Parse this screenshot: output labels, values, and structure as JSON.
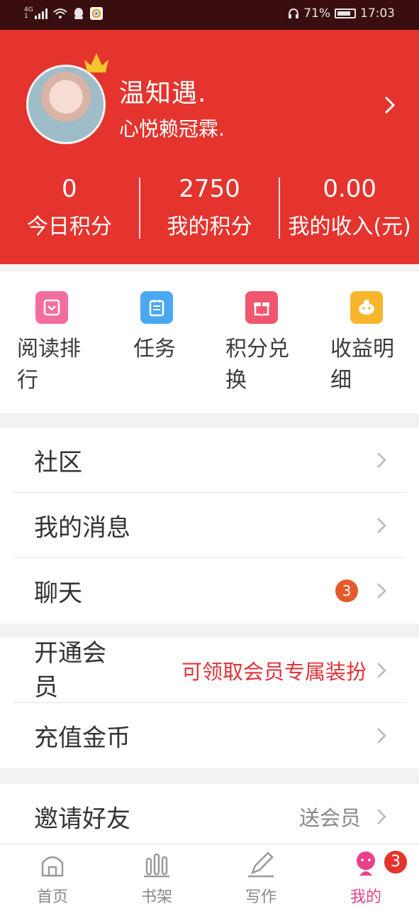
{
  "status_bar": {
    "network": "4G",
    "battery": "71%",
    "time": "17:03"
  },
  "profile": {
    "name": "温知遇.",
    "signature": "心悦赖冠霖."
  },
  "stats": [
    {
      "value": "0",
      "label": "今日积分"
    },
    {
      "value": "2750",
      "label": "我的积分"
    },
    {
      "value": "0.00",
      "label": "我的收入(元)"
    }
  ],
  "quick_actions": [
    {
      "label": "阅读排行",
      "icon": "ranking-icon",
      "color": "#f36da0"
    },
    {
      "label": "任务",
      "icon": "task-icon",
      "color": "#4aa8f0"
    },
    {
      "label": "积分兑换",
      "icon": "gift-icon",
      "color": "#f0566e"
    },
    {
      "label": "收益明细",
      "icon": "earnings-icon",
      "color": "#f7b62b"
    }
  ],
  "menu_group1": [
    {
      "label": "社区"
    },
    {
      "label": "我的消息"
    },
    {
      "label": "聊天",
      "badge": "3"
    }
  ],
  "menu_group2": [
    {
      "label": "开通会员",
      "note": "可领取会员专属装扮"
    },
    {
      "label": "充值金币"
    }
  ],
  "menu_group3": [
    {
      "label": "邀请好友",
      "note": "送会员"
    }
  ],
  "tabbar": [
    {
      "label": "首页"
    },
    {
      "label": "书架"
    },
    {
      "label": "写作"
    },
    {
      "label": "我的",
      "badge": "3"
    }
  ],
  "colors": {
    "header": "#e4342d",
    "active_tab": "#e8418c",
    "note_red": "#e0333a"
  }
}
